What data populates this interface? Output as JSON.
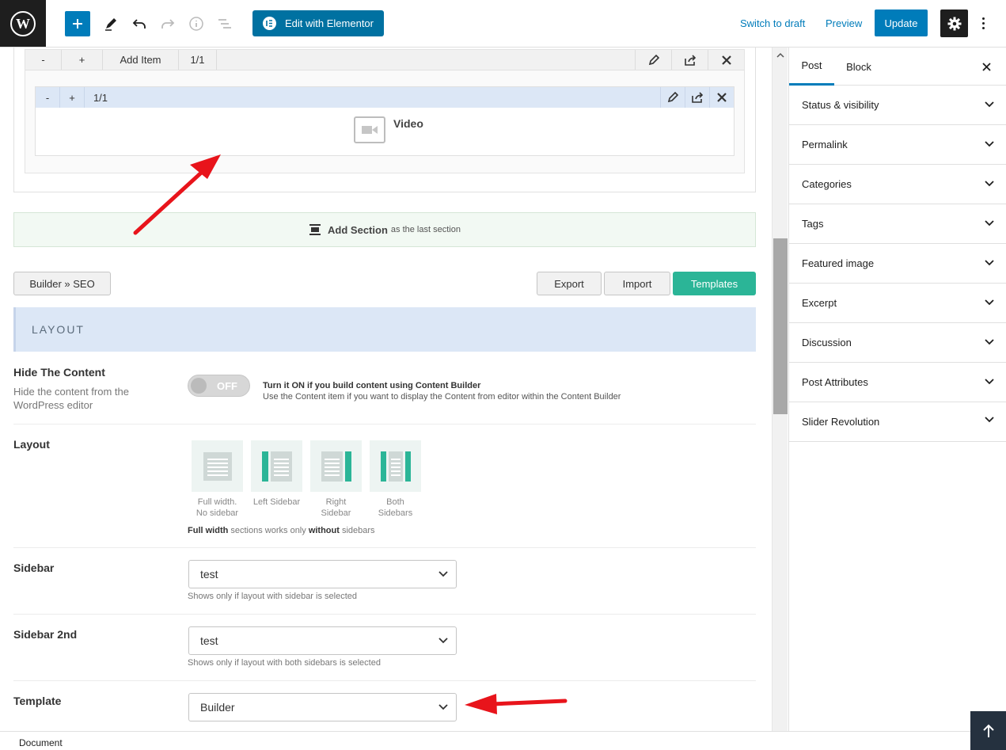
{
  "topbar": {
    "elementor_label": "Edit with Elementor",
    "switch_draft": "Switch to draft",
    "preview": "Preview",
    "update": "Update"
  },
  "builder": {
    "wrap": {
      "minus": "-",
      "plus": "+",
      "add_item": "Add Item",
      "size": "1/1"
    },
    "item": {
      "minus": "-",
      "plus": "+",
      "size": "1/1",
      "label": "Video"
    },
    "add_section": {
      "label": "Add Section",
      "suffix": "as the last section"
    }
  },
  "actions": {
    "builder_seo": "Builder » SEO",
    "export": "Export",
    "import": "Import",
    "templates": "Templates"
  },
  "layout_section": {
    "heading": "LAYOUT",
    "hide_content": {
      "title": "Hide The Content",
      "desc": "Hide the content from the WordPress editor",
      "toggle_label": "OFF",
      "note_bold": "Turn it ON if you build content using Content Builder",
      "note": "Use the Content item if you want to display the Content from editor within the Content Builder"
    },
    "layout": {
      "title": "Layout",
      "options": [
        {
          "line1": "Full width.",
          "line2": "No sidebar"
        },
        {
          "line1": "Left Sidebar",
          "line2": ""
        },
        {
          "line1": "Right",
          "line2": "Sidebar"
        },
        {
          "line1": "Both",
          "line2": "Sidebars"
        }
      ],
      "note_b1": "Full width",
      "note_t1": " sections works only ",
      "note_b2": "without",
      "note_t2": " sidebars"
    },
    "sidebar": {
      "title": "Sidebar",
      "value": "test",
      "note": "Shows only if layout with sidebar is selected"
    },
    "sidebar2": {
      "title": "Sidebar 2nd",
      "value": "test",
      "note": "Shows only if layout with both sidebars is selected"
    },
    "template": {
      "title": "Template",
      "value": "Builder"
    }
  },
  "sidebar": {
    "tabs": [
      "Post",
      "Block"
    ],
    "panels": [
      "Status & visibility",
      "Permalink",
      "Categories",
      "Tags",
      "Featured image",
      "Excerpt",
      "Discussion",
      "Post Attributes",
      "Slider Revolution"
    ]
  },
  "footer": {
    "breadcrumb": "Document"
  },
  "colors": {
    "primary": "#007cba",
    "templates": "#2bb597",
    "arrow": "#e8141b"
  }
}
